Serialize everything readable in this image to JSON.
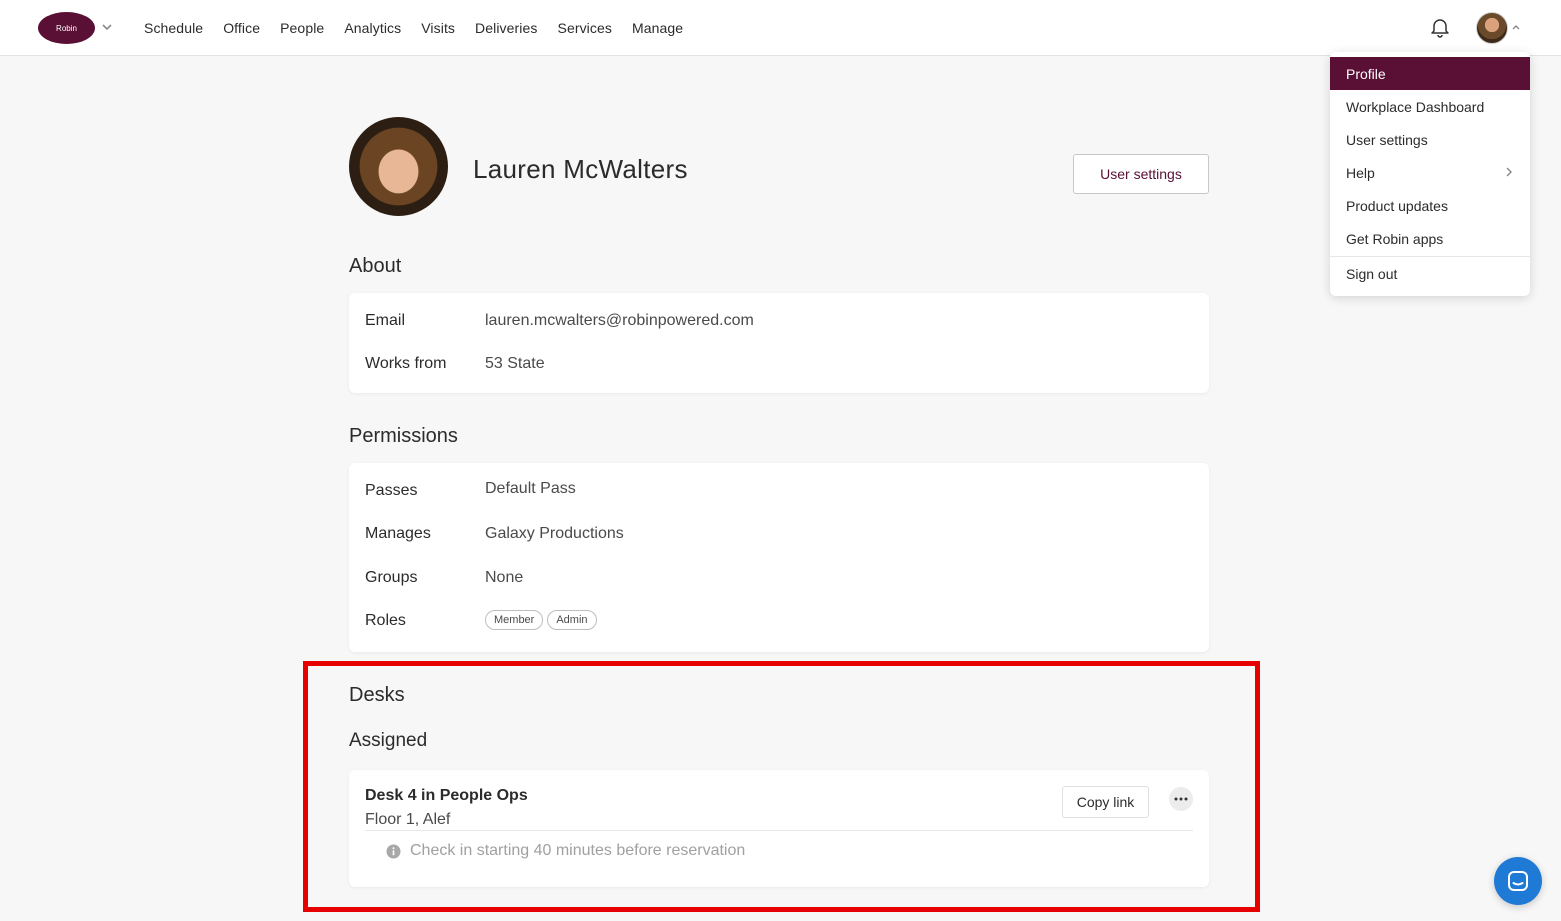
{
  "header": {
    "logo_text": "Robin",
    "nav": [
      "Schedule",
      "Office",
      "People",
      "Analytics",
      "Visits",
      "Deliveries",
      "Services",
      "Manage"
    ]
  },
  "menu": {
    "items": [
      "Profile",
      "Workplace Dashboard",
      "User settings",
      "Help",
      "Product updates",
      "Get Robin apps"
    ],
    "sign_out": "Sign out"
  },
  "profile": {
    "name": "Lauren McWalters",
    "user_settings_label": "User settings"
  },
  "about": {
    "title": "About",
    "email_label": "Email",
    "email_value": "lauren.mcwalters@robinpowered.com",
    "works_from_label": "Works from",
    "works_from_value": "53 State"
  },
  "permissions": {
    "title": "Permissions",
    "passes_label": "Passes",
    "passes_value": "Default Pass",
    "manages_label": "Manages",
    "manages_value": "Galaxy Productions",
    "groups_label": "Groups",
    "groups_value": "None",
    "roles_label": "Roles",
    "roles": [
      "Member",
      "Admin"
    ]
  },
  "desks": {
    "title": "Desks",
    "assigned_title": "Assigned",
    "desk_name": "Desk 4 in People Ops",
    "desk_location": "Floor 1, Alef",
    "copy_link_label": "Copy link",
    "checkin_note": "Check in starting 40 minutes before reservation"
  },
  "colors": {
    "brand": "#5a0f35",
    "highlight": "#e60000",
    "chat": "#1f7ad6"
  }
}
